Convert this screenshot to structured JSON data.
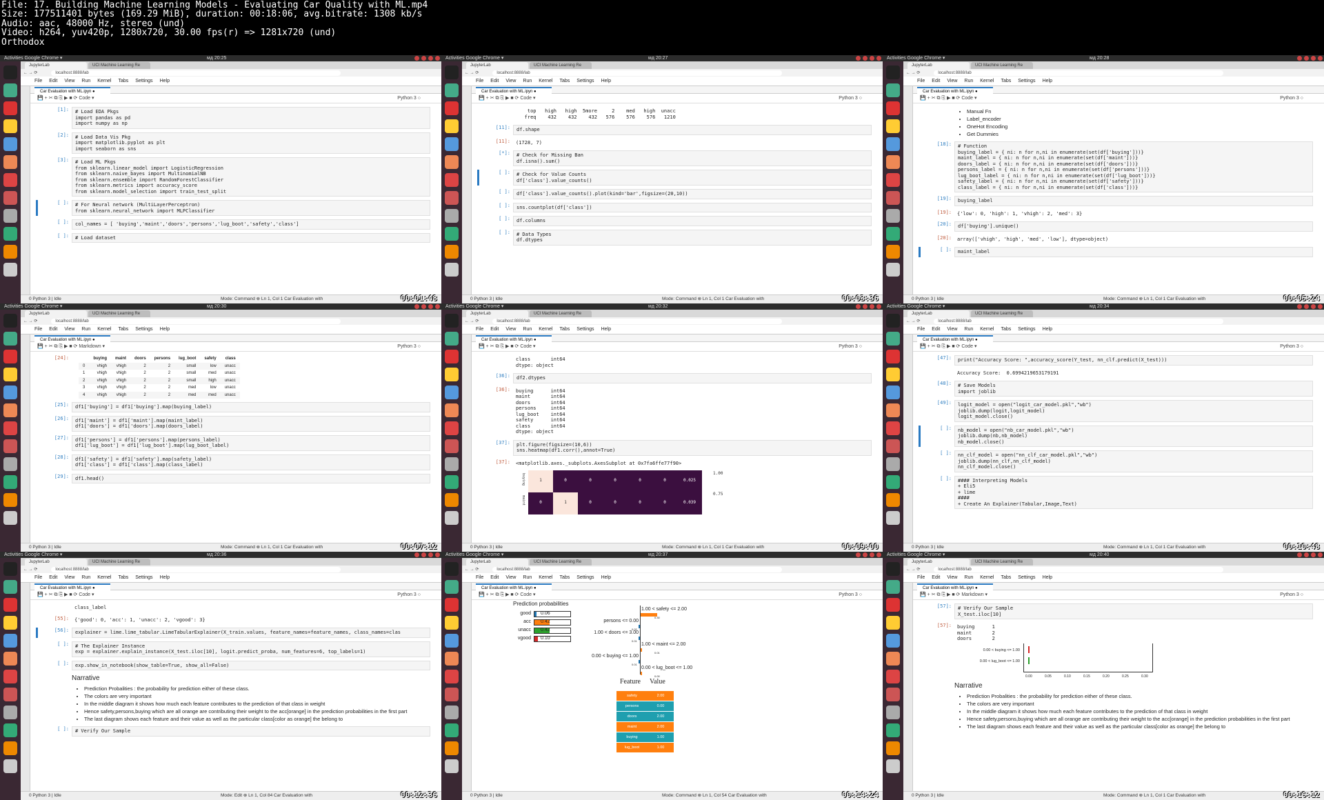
{
  "header": {
    "lines": [
      "File: 17. Building Machine Learning Models - Evaluating Car Quality with ML.mp4",
      "Size: 177511401 bytes (169.29 MiB), duration: 00:18:06, avg.bitrate: 1308 kb/s",
      "Audio: aac, 48000 Hz, stereo (und)",
      "Video: h264, yuv420p, 1280x720, 30.00 fps(r) => 1281x720 (und)",
      "Orthodox"
    ]
  },
  "common": {
    "activities": "Activities",
    "chrome_app": "Google Chrome ▾",
    "tab1": "JupyterLab",
    "tab2": "UCI Machine Learning Re",
    "url": "localhost:8888/lab",
    "menu": [
      "File",
      "Edit",
      "View",
      "Run",
      "Kernel",
      "Tabs",
      "Settings",
      "Help"
    ],
    "notebook_tab": "Car Evaluation with ML.ipyn",
    "kernel": "Python 3",
    "status_left": "0  Python 3 | Idle",
    "status_file": "Car Evaluation with"
  },
  "tiles": [
    {
      "clock": "ᴍд 20:25",
      "celltype": "Code",
      "mode": "Mode: Command",
      "pos": "Ln 1, Col 1",
      "timestamp": "00:01:48",
      "cells": [
        {
          "p": "[1]:",
          "code": "# Load EDA Pkgs\nimport pandas as pd\nimport numpy as np"
        },
        {
          "p": "[2]:",
          "code": "# Load Data Vis Pkg\nimport matplotlib.pyplot as plt\nimport seaborn as sns"
        },
        {
          "p": "[3]:",
          "code": "# Load ML Pkgs\nfrom sklearn.linear_model import LogisticRegression\nfrom sklearn.naive_bayes import MultinomialNB\nfrom sklearn.ensemble import RandomForestClassifier\nfrom sklearn.metrics import accuracy_score\nfrom sklearn.model_selection import train_test_split"
        },
        {
          "p": "[ ]:",
          "code": "# For Neural network (MultiLayerPerceptron)\nfrom sklearn.neural_network import MLPClassifier",
          "sel": true
        },
        {
          "p": "[ ]:",
          "code": "col_names = [ 'buying','maint','doors','persons','lug_boot','safety','class']"
        },
        {
          "p": "[ ]:",
          "code": "# Load dataset"
        }
      ]
    },
    {
      "clock": "ᴍд 20:27",
      "celltype": "Code",
      "mode": "Mode: Command",
      "pos": "Ln 1, Col 1",
      "timestamp": "00:03:36",
      "cells": [
        {
          "p": "",
          "out": "    top   high   high  5more     2    med   high  unacc\n   freq    432    432    432   576    576    576   1210"
        },
        {
          "p": "[11]:",
          "code": "df.shape"
        },
        {
          "p": "[11]:",
          "out": "(1728, 7)",
          "o": true
        },
        {
          "p": "[*]:",
          "code": "# Check for Missing Ban\ndf.isna().sum()"
        },
        {
          "p": "[ ]:",
          "code": "# Check for Value Counts\ndf['class'].value_counts()",
          "sel": true
        },
        {
          "p": "[ ]:",
          "code": "df['class'].value_counts().plot(kind='bar',figsize=(20,10))"
        },
        {
          "p": "[ ]:",
          "code": "sns.countplot(df['class'])"
        },
        {
          "p": "[ ]:",
          "code": "df.columns"
        },
        {
          "p": "[ ]:",
          "code": "# Data Types\ndf.dtypes"
        }
      ]
    },
    {
      "clock": "ᴍд 20:28",
      "celltype": "Code",
      "mode": "Mode: Command",
      "pos": "Ln 1, Col 1",
      "timestamp": "00:05:24",
      "bullets": [
        "Manual Fn",
        "Label_encoder",
        "OneHot Encoding",
        "Get Dummies"
      ],
      "cells": [
        {
          "p": "[18]:",
          "code": "# Function\nbuying_label = { ni: n for n,ni in enumerate(set(df['buying']))}\nmaint_label = { ni: n for n,ni in enumerate(set(df['maint']))}\ndoors_label = { ni: n for n,ni in enumerate(set(df['doors']))}\npersons_label = { ni: n for n,ni in enumerate(set(df['persons']))}\nlug_boot_label = { ni: n for n,ni in enumerate(set(df['lug_boot']))}\nsafety_label = { ni: n for n,ni in enumerate(set(df['safety']))}\nclass_label = { ni: n for n,ni in enumerate(set(df['class']))}"
        },
        {
          "p": "[19]:",
          "code": "buying_label"
        },
        {
          "p": "[19]:",
          "out": "{'low': 0, 'high': 1, 'vhigh': 2, 'med': 3}",
          "o": true
        },
        {
          "p": "[20]:",
          "code": "df['buying'].unique()"
        },
        {
          "p": "[20]:",
          "out": "array(['vhigh', 'high', 'med', 'low'], dtype=object)",
          "o": true
        },
        {
          "p": "[ ]:",
          "code": "maint_label",
          "sel": true
        }
      ]
    },
    {
      "clock": "ᴍд 20:30",
      "celltype": "Markdown",
      "mode": "Mode: Command",
      "pos": "Ln 1, Col 1",
      "timestamp": "00:07:12",
      "table": {
        "p": "[24]:",
        "head": [
          "",
          "buying",
          "maint",
          "doors",
          "persons",
          "lug_boot",
          "safety",
          "class"
        ],
        "rows": [
          [
            "0",
            "vhigh",
            "vhigh",
            "2",
            "2",
            "small",
            "low",
            "unacc"
          ],
          [
            "1",
            "vhigh",
            "vhigh",
            "2",
            "2",
            "small",
            "med",
            "unacc"
          ],
          [
            "2",
            "vhigh",
            "vhigh",
            "2",
            "2",
            "small",
            "high",
            "unacc"
          ],
          [
            "3",
            "vhigh",
            "vhigh",
            "2",
            "2",
            "med",
            "low",
            "unacc"
          ],
          [
            "4",
            "vhigh",
            "vhigh",
            "2",
            "2",
            "med",
            "med",
            "unacc"
          ]
        ]
      },
      "cells": [
        {
          "p": "[25]:",
          "code": "df1['buying'] = df1['buying'].map(buying_label)"
        },
        {
          "p": "[26]:",
          "code": "df1['maint'] = df1['maint'].map(maint_label)\ndf1['doors'] = df1['doors'].map(doors_label)"
        },
        {
          "p": "[27]:",
          "code": "df1['persons'] = df1['persons'].map(persons_label)\ndf1['lug_boot'] = df1['lug_boot'].map(lug_boot_label)"
        },
        {
          "p": "[28]:",
          "code": "df1['safety'] = df1['safety'].map(safety_label)\ndf1['class'] = df1['class'].map(class_label)"
        },
        {
          "p": "[29]:",
          "code": "df1.head()"
        }
      ]
    },
    {
      "clock": "ᴍд 20:32",
      "celltype": "Code",
      "mode": "Mode: Command",
      "pos": "Ln 1, Col 1",
      "timestamp": "00:09:00",
      "cells": [
        {
          "p": "",
          "out": "class       int64\ndtype: object"
        },
        {
          "p": "[36]:",
          "code": "df2.dtypes"
        },
        {
          "p": "[36]:",
          "out": "buying      int64\nmaint       int64\ndoors       int64\npersons     int64\nlug_boot    int64\nsafety      int64\nclass       int64\ndtype: object",
          "o": true
        },
        {
          "p": "[37]:",
          "code": "plt.figure(figsize=(10,6))\nsns.heatmap(df1.corr(),annot=True)"
        },
        {
          "p": "[37]:",
          "out": "<matplotlib.axes._subplots.AxesSubplot at 0x7fa6ffe77f90>",
          "o": true
        }
      ],
      "heat": {
        "rows": [
          "buying",
          "maint"
        ],
        "vals": [
          [
            "1",
            "0",
            "0",
            "0",
            "0",
            "0",
            "0.025"
          ],
          [
            "0",
            "1",
            "0",
            "0",
            "0",
            "0",
            "0.039"
          ]
        ],
        "cbar": [
          "1.00",
          "0.75"
        ]
      }
    },
    {
      "clock": "ᴍд 20:34",
      "celltype": "Code",
      "mode": "Mode: Command",
      "pos": "Ln 1, Col 1",
      "timestamp": "00:10:48",
      "cells": [
        {
          "p": "[47]:",
          "code": "print(\"Accuracy Score: \",accuracy_score(Y_test, nn_clf.predict(X_test)))"
        },
        {
          "p": "",
          "out": "Accuracy Score:  0.6994219653179191"
        },
        {
          "p": "[48]:",
          "code": "# Save Models\nimport joblib"
        },
        {
          "p": "[49]:",
          "code": "logit_model = open(\"logit_car_model.pkl\",\"wb\")\njoblib.dump(logit,logit_model)\nlogit_model.close()"
        },
        {
          "p": "[ ]:",
          "code": "nb_model = open(\"nb_car_model.pkl\",\"wb\")\njoblib.dump(nb,nb_model)\nnb_model.close()",
          "sel": true
        },
        {
          "p": "[ ]:",
          "code": "nn_clf_model = open(\"nn_clf_car_model.pkl\",\"wb\")\njoblib.dump(nn_clf,nn_clf_model)\nnn_clf_model.close()"
        },
        {
          "p": "[ ]:",
          "code": "#### Interpreting Models\n+ Eli5\n+ lime\n####\n+ Create An Explainer(Tabular,Image,Text)"
        }
      ]
    },
    {
      "clock": "ᴍд 20:36",
      "celltype": "Code",
      "mode": "Mode: Edit",
      "pos": "Ln 1, Col 84",
      "timestamp": "00:12:36",
      "cells": [
        {
          "p": "",
          "out": "class_label"
        },
        {
          "p": "[55]:",
          "out": "{'good': 0, 'acc': 1, 'unacc': 2, 'vgood': 3}",
          "o": true
        },
        {
          "p": "[56]:",
          "code": "explainer = lime.lime_tabular.LimeTabularExplainer(X_train.values, feature_names=feature_names, class_names=clas",
          "sel": true
        },
        {
          "p": "[ ]:",
          "code": "# The Explainer Instance\nexp = explainer.explain_instance(X_test.iloc[10], logit.predict_proba, num_features=6, top_labels=1)"
        },
        {
          "p": "[ ]:",
          "code": "exp.show_in_notebook(show_table=True, show_all=False)"
        }
      ],
      "narrative": {
        "title": "Narrative",
        "items": [
          "Prediction Probalities : the probability for prediction either of these class.",
          "The colors are very important",
          "In the middle diagram it shows how much each feature contributes to the prediction of that class in weight",
          "Hence safety,persons,buying which are all orange are contributing their weight to the acc[orange] in the prediction probabilities in the first part",
          "The last diagram shows each feature and their value as well as the particular class[color as orange] the belong to"
        ],
        "next": "# Verify Our Sample"
      }
    },
    {
      "clock": "ᴍд 20:37",
      "celltype": "Code",
      "mode": "Mode: Command",
      "pos": "Ln 1, Col 54",
      "timestamp": "00:14:24",
      "lime": {
        "title": "Prediction probabilities",
        "probs": [
          {
            "name": "good",
            "v": "0.06",
            "f": 0.06,
            "c": "#1f77b4"
          },
          {
            "name": "acc",
            "v": "0.42",
            "f": 0.42,
            "c": "#ff7f0e"
          },
          {
            "name": "unacc",
            "v": "0.42",
            "f": 0.42,
            "c": "#2ca02c"
          },
          {
            "name": "vgood",
            "v": "0.10",
            "f": 0.1,
            "c": "#d62728"
          }
        ],
        "top_left": "NOT acc",
        "top_right": "acc",
        "conds": [
          {
            "l": "1.00 < safety <= 2.00",
            "side": "r",
            "w": "0.30"
          },
          {
            "l": "persons <= 0.00",
            "side": "l",
            "w": "0.02"
          },
          {
            "l": "1.00 < doors <= 3.00",
            "side": "l",
            "w": "0.01"
          },
          {
            "l": "1.00 < maint <= 2.00",
            "side": "r",
            "w": "0.01"
          },
          {
            "l": "0.00 < buying <= 1.00",
            "side": "l",
            "w": "0.01"
          },
          {
            "l": "0.00 < lug_boot <= 1.00",
            "side": "r",
            "w": "0.00"
          }
        ],
        "fv_title_f": "Feature",
        "fv_title_v": "Value",
        "fv": [
          {
            "f": "safety",
            "v": "2.00",
            "c": "#ff7f0e"
          },
          {
            "f": "persons",
            "v": "0.00",
            "c": "#1f9faf"
          },
          {
            "f": "doors",
            "v": "2.00",
            "c": "#1f9faf"
          },
          {
            "f": "maint",
            "v": "2.00",
            "c": "#ff7f0e"
          },
          {
            "f": "buying",
            "v": "1.00",
            "c": "#1f9faf"
          },
          {
            "f": "lug_boot",
            "v": "1.00",
            "c": "#ff7f0e"
          }
        ]
      }
    },
    {
      "clock": "ᴍд 20:40",
      "celltype": "Markdown",
      "mode": "Mode: Command",
      "pos": "Ln 1, Col 1",
      "timestamp": "00:16:12",
      "axis": {
        "conds": [
          "0.00 < buying <= 1.00",
          "0.00 < lug_boot <= 1.00"
        ],
        "ticks": [
          "0.00",
          "0.05",
          "0.10",
          "0.15",
          "0.20",
          "0.25",
          "0.30"
        ]
      },
      "narrative": {
        "title": "Narrative",
        "items": [
          "Prediction Probalities : the probability for prediction either of these class.",
          "The colors are very important",
          "In the middle diagram it shows how much each feature contributes to the prediction of that class in weight",
          "Hence safety,persons,buying which are all orange are contributing their weight to the acc[orange] in the prediction probabilities in the first part",
          "The last diagram shows each feature and their value as well as the particular class[color as orange] the belong to"
        ]
      },
      "cells": [
        {
          "p": "[57]:",
          "code": "# Verify Our Sample\nX_test.iloc[10]"
        },
        {
          "p": "[57]:",
          "out": "buying      1\nmaint       2\ndoors       2",
          "o": true
        }
      ]
    }
  ]
}
